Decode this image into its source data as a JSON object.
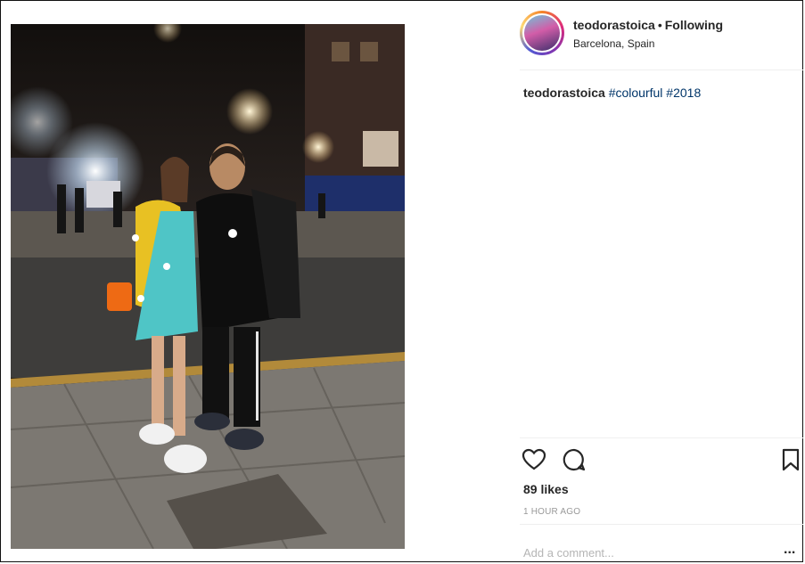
{
  "post": {
    "username": "teodorastoica",
    "separator": "•",
    "follow_status": "Following",
    "location": "Barcelona, Spain",
    "caption_user": "teodorastoica",
    "caption_tags": [
      "#colourful",
      "#2018"
    ],
    "likes": "89 likes",
    "time_ago": "1 HOUR AGO",
    "comment_placeholder": "Add a comment...",
    "more_label": "..."
  },
  "icons": {
    "like": "heart-icon",
    "comment": "comment-bubble-icon",
    "save": "bookmark-icon",
    "more": "more-options-icon"
  },
  "colors": {
    "hashtag": "#003569",
    "text": "#262626",
    "muted": "#999999",
    "divider": "#efefef"
  }
}
